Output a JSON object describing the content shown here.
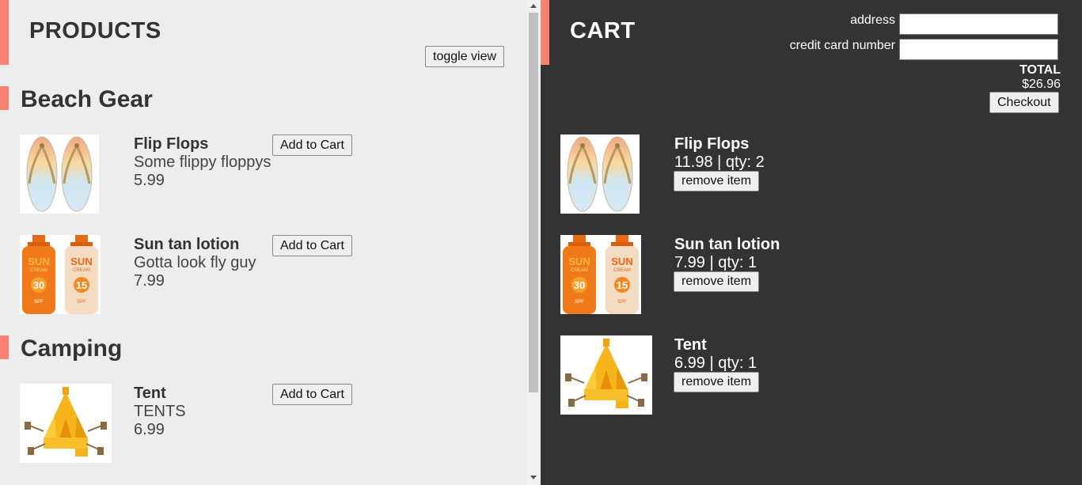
{
  "products": {
    "title": "PRODUCTS",
    "toggle_label": "toggle view",
    "categories": [
      {
        "name": "Beach Gear",
        "items": [
          {
            "name": "Flip Flops",
            "description": "Some flippy floppys",
            "price": "5.99",
            "button": "Add to Cart",
            "image": "flip-flops-image"
          },
          {
            "name": "Sun tan lotion",
            "description": "Gotta look fly guy",
            "price": "7.99",
            "button": "Add to Cart",
            "image": "sun-cream-image"
          }
        ]
      },
      {
        "name": "Camping",
        "items": [
          {
            "name": "Tent",
            "description": "TENTS",
            "price": "6.99",
            "button": "Add to Cart",
            "image": "tent-image"
          }
        ]
      }
    ]
  },
  "cart": {
    "title": "CART",
    "address_label": "address",
    "address_value": "",
    "card_label": "credit card number",
    "card_value": "",
    "total_label": "TOTAL",
    "total_value": "$26.96",
    "checkout_label": "Checkout",
    "items": [
      {
        "name": "Flip Flops",
        "line": "11.98 | qty: 2",
        "button": "remove item",
        "image": "flip-flops-image"
      },
      {
        "name": "Sun tan lotion",
        "line": "7.99 | qty: 1",
        "button": "remove item",
        "image": "sun-cream-image"
      },
      {
        "name": "Tent",
        "line": "6.99 | qty: 1",
        "button": "remove item",
        "image": "tent-image"
      }
    ]
  },
  "sun_cream": {
    "brand": "SUN",
    "sub": "CREAM",
    "spf_a": "30",
    "spf_b": "15",
    "spf_label": "SPF"
  },
  "colors": {
    "accent": "#fa8072",
    "left_bg": "#ededed",
    "right_bg": "#333333",
    "orange": "#f07a1a",
    "yellow": "#f5b51b"
  }
}
